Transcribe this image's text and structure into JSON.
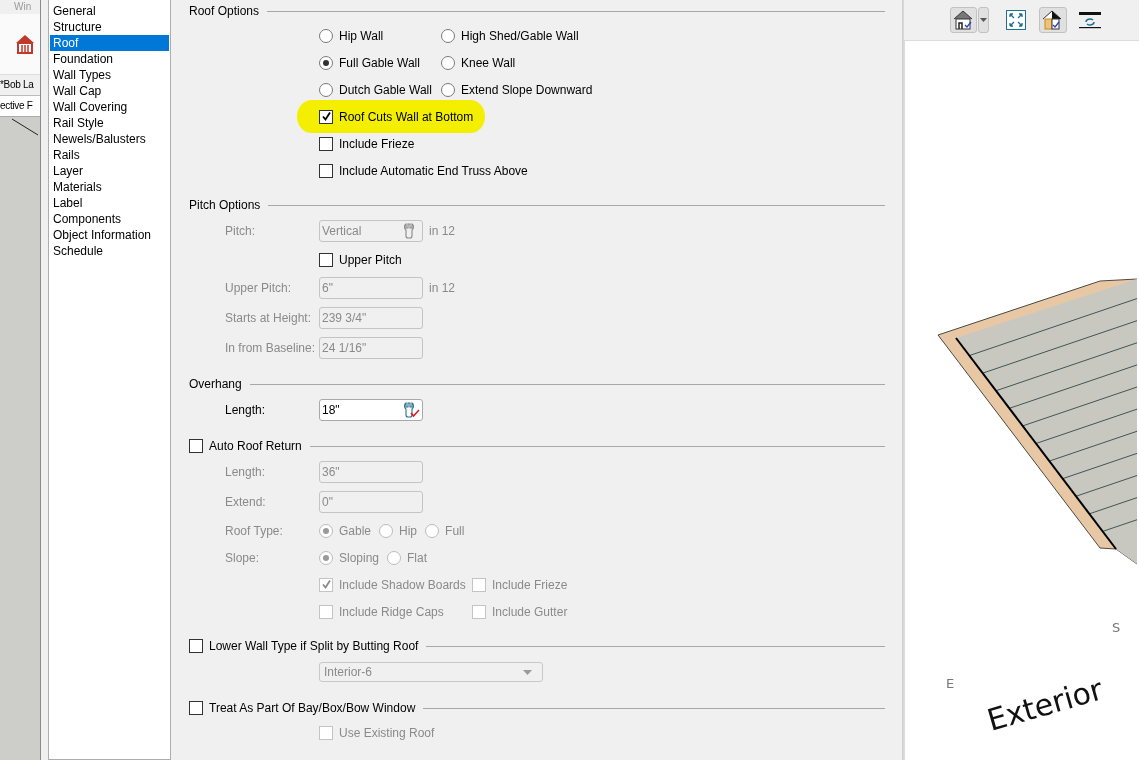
{
  "background_app": {
    "menu_text": "Win",
    "tab": "*Bob La",
    "view_tab": "ective F"
  },
  "categories": [
    {
      "label": "General",
      "selected": false
    },
    {
      "label": "Structure",
      "selected": false
    },
    {
      "label": "Roof",
      "selected": true
    },
    {
      "label": "Foundation",
      "selected": false
    },
    {
      "label": "Wall Types",
      "selected": false
    },
    {
      "label": "Wall Cap",
      "selected": false
    },
    {
      "label": "Wall Covering",
      "selected": false
    },
    {
      "label": "Rail Style",
      "selected": false
    },
    {
      "label": "Newels/Balusters",
      "selected": false
    },
    {
      "label": "Rails",
      "selected": false
    },
    {
      "label": "Layer",
      "selected": false
    },
    {
      "label": "Materials",
      "selected": false
    },
    {
      "label": "Label",
      "selected": false
    },
    {
      "label": "Components",
      "selected": false
    },
    {
      "label": "Object Information",
      "selected": false
    },
    {
      "label": "Schedule",
      "selected": false
    }
  ],
  "sections": [
    {
      "title": "Roof Options",
      "kind": "label",
      "rows": [
        {
          "kind": "radio_pair",
          "options": [
            {
              "label": "Hip Wall",
              "selected": false
            },
            {
              "label": "High Shed/Gable Wall",
              "selected": false
            }
          ]
        },
        {
          "kind": "radio_pair",
          "options": [
            {
              "label": "Full Gable Wall",
              "selected": true
            },
            {
              "label": "Knee Wall",
              "selected": false
            }
          ]
        },
        {
          "kind": "radio_pair",
          "options": [
            {
              "label": "Dutch Gable Wall",
              "selected": false
            },
            {
              "label": "Extend Slope Downward",
              "selected": false
            }
          ]
        },
        {
          "kind": "checkbox",
          "label": "Roof Cuts Wall at Bottom",
          "checked": true,
          "disabled": false,
          "highlighted": true
        },
        {
          "kind": "checkbox",
          "label": "Include Frieze",
          "checked": false,
          "disabled": false,
          "highlighted": false
        },
        {
          "kind": "checkbox",
          "label": "Include Automatic End Truss Above",
          "checked": false,
          "disabled": false,
          "highlighted": false
        }
      ]
    },
    {
      "title": "Pitch Options",
      "kind": "label",
      "rows": [
        {
          "kind": "field",
          "label": "Pitch:",
          "value": "Vertical",
          "unit": "in 12",
          "tool_button": true,
          "tool_verified": false,
          "disabled": true
        },
        {
          "kind": "checkbox",
          "label": "Upper Pitch",
          "checked": false,
          "disabled": false,
          "highlighted": false
        },
        {
          "kind": "field",
          "label": "Upper Pitch:",
          "value": "6\"",
          "unit": "in 12",
          "disabled": true
        },
        {
          "kind": "field",
          "label": "Starts at Height:",
          "value": "239 3/4\"",
          "disabled": true
        },
        {
          "kind": "field",
          "label": "In from Baseline:",
          "value": "24 1/16\"",
          "disabled": true
        }
      ]
    },
    {
      "title": "Overhang",
      "kind": "label",
      "rows": [
        {
          "kind": "field",
          "label": "Length:",
          "value": "18\"",
          "tool_button": true,
          "tool_verified": true,
          "disabled": false
        }
      ]
    },
    {
      "title": "Auto Roof Return",
      "kind": "checkbox",
      "checked": false,
      "rows": [
        {
          "kind": "field",
          "label": "Length:",
          "value": "36\"",
          "disabled": true
        },
        {
          "kind": "field",
          "label": "Extend:",
          "value": "0\"",
          "disabled": true
        },
        {
          "kind": "radios",
          "label": "Roof Type:",
          "disabled": true,
          "options": [
            {
              "label": "Gable",
              "selected": true
            },
            {
              "label": "Hip",
              "selected": false
            },
            {
              "label": "Full",
              "selected": false
            }
          ]
        },
        {
          "kind": "radios",
          "label": "Slope:",
          "disabled": true,
          "options": [
            {
              "label": "Sloping",
              "selected": true
            },
            {
              "label": "Flat",
              "selected": false
            }
          ]
        },
        {
          "kind": "checkbox_pair",
          "disabled": true,
          "options": [
            {
              "label": "Include Shadow Boards",
              "checked": true
            },
            {
              "label": "Include Frieze",
              "checked": false
            }
          ]
        },
        {
          "kind": "checkbox_pair",
          "disabled": true,
          "options": [
            {
              "label": "Include Ridge Caps",
              "checked": false
            },
            {
              "label": "Include Gutter",
              "checked": false
            }
          ]
        }
      ]
    },
    {
      "title": "Lower Wall Type if Split by Butting Roof",
      "kind": "checkbox",
      "checked": false,
      "rows": [
        {
          "kind": "dropdown",
          "value": "Interior-6",
          "disabled": true
        }
      ]
    },
    {
      "title": "Treat As Part Of Bay/Box/Bow Window",
      "kind": "checkbox",
      "checked": false,
      "rows": [
        {
          "kind": "checkbox",
          "label": "Use Existing Roof",
          "checked": false,
          "disabled": true,
          "highlighted": false
        }
      ]
    }
  ],
  "preview": {
    "labels": [
      {
        "kind": "compass",
        "text": "S"
      },
      {
        "kind": "compass",
        "text": "E"
      },
      {
        "kind": "room",
        "text": "Exterior"
      }
    ]
  }
}
